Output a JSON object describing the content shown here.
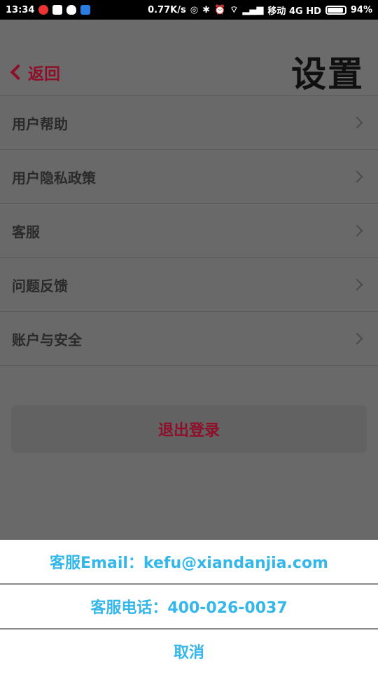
{
  "statusbar": {
    "time": "13:34",
    "speed": "0.77K/s",
    "carrier": "移动 4G HD",
    "battery": "94%"
  },
  "header": {
    "back_label": "返回",
    "title": "设置"
  },
  "menu": {
    "items": [
      {
        "label": "用户帮助"
      },
      {
        "label": "用户隐私政策"
      },
      {
        "label": "客服"
      },
      {
        "label": "问题反馈"
      },
      {
        "label": "账户与安全"
      }
    ]
  },
  "logout": {
    "label": "退出登录"
  },
  "sheet": {
    "email": "客服Email：kefu@xiandanjia.com",
    "phone": "客服电话：400-026-0037",
    "cancel": "取消"
  },
  "colors": {
    "accent": "#8f0f2a",
    "sheet_text": "#35b7ea",
    "overlay": "#696969"
  }
}
